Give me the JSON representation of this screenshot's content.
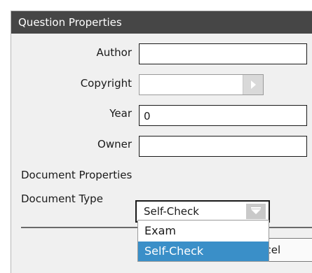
{
  "dialog": {
    "title": "Question Properties"
  },
  "fields": {
    "author": {
      "label": "Author",
      "value": ""
    },
    "copyright": {
      "label": "Copyright",
      "value": ""
    },
    "year": {
      "label": "Year",
      "value": "0"
    },
    "owner": {
      "label": "Owner",
      "value": ""
    }
  },
  "section": {
    "heading": "Document Properties"
  },
  "document_type": {
    "label": "Document Type",
    "selected": "Self-Check",
    "options": [
      "Exam",
      "Self-Check"
    ]
  },
  "buttons": {
    "cancel_visible_text": "ncel"
  },
  "colors": {
    "titlebar": "#464646",
    "highlight": "#3a8fc8",
    "dialog_bg": "#f0f0f0"
  }
}
